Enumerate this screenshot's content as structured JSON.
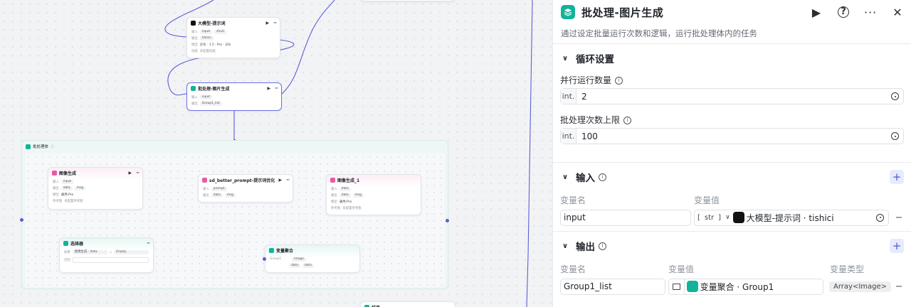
{
  "canvas": {
    "nodes": {
      "llm": {
        "title": "大模型-提示词",
        "in_label": "输入",
        "in_tags": [
          "input",
          "zhuti"
        ],
        "out_label": "输出",
        "out_tags": [
          "tishici"
        ],
        "model_label": "模型",
        "model_value": "豆包 · 1.5 · Pro · 32k",
        "skill_label": "技能",
        "skill_value": "未配置技能"
      },
      "batch": {
        "title": "批处理-图片生成",
        "in_label": "输入",
        "in_tags": [
          "input"
        ],
        "out_label": "输出",
        "out_tags": [
          "Group1_list"
        ]
      },
      "body": {
        "title": "批处理体"
      },
      "img1": {
        "title": "图像生成",
        "in_label": "输入",
        "in_tags": [
          "input"
        ],
        "out_label": "输出",
        "out_tags": [
          "data",
          "msg"
        ],
        "model_label": "模型",
        "model_value": "通用-Pro",
        "ref_label": "参考图",
        "ref_value": "未配置参考图"
      },
      "sd": {
        "title": "sd_better_prompt-提示词优化",
        "in_label": "输入",
        "in_tags": [
          "prompt"
        ],
        "out_label": "输出",
        "out_tags": [
          "data",
          "msg"
        ]
      },
      "img2": {
        "title": "图像生成_1",
        "in_label": "输入",
        "in_tags": [
          "data"
        ],
        "out_label": "输出",
        "out_tags": [
          "data",
          "msg"
        ],
        "model_label": "模型",
        "model_value": "通用-Pro",
        "ref_label": "参考图",
        "ref_value": "未配置参考图"
      },
      "selector": {
        "title": "选择器",
        "if_label": "如果",
        "cond_left": "图像生成 · data",
        "cond_op": "=",
        "cond_right": "Empty",
        "else_label": "否则"
      },
      "agg": {
        "title": "变量聚合",
        "group_label": "Group1",
        "tags": [
          "image",
          "data",
          "data"
        ]
      },
      "bottom": {
        "title": "结束"
      }
    }
  },
  "panel": {
    "title": "批处理-图片生成",
    "description": "通过设定批量运行次数和逻辑，运行批处理体内的任务",
    "loop": {
      "title": "循环设置",
      "parallel_label": "并行运行数量",
      "parallel_prefix": "int.",
      "parallel_value": "2",
      "limit_label": "批处理次数上限",
      "limit_prefix": "int.",
      "limit_value": "100"
    },
    "input": {
      "title": "输入",
      "col_name": "变量名",
      "col_value": "变量值",
      "row_name": "input",
      "row_type": "str",
      "row_ref": "大模型-提示词 · tishici"
    },
    "output": {
      "title": "输出",
      "col_name": "变量名",
      "col_value": "变量值",
      "col_type": "变量类型",
      "row_name": "Group1_list",
      "row_ref": "变量聚合 · Group1",
      "row_type": "Array<Image>"
    }
  },
  "colors": {
    "accent": "#5a5fd6",
    "teal": "#13b39a",
    "pink": "#e85aa8"
  }
}
